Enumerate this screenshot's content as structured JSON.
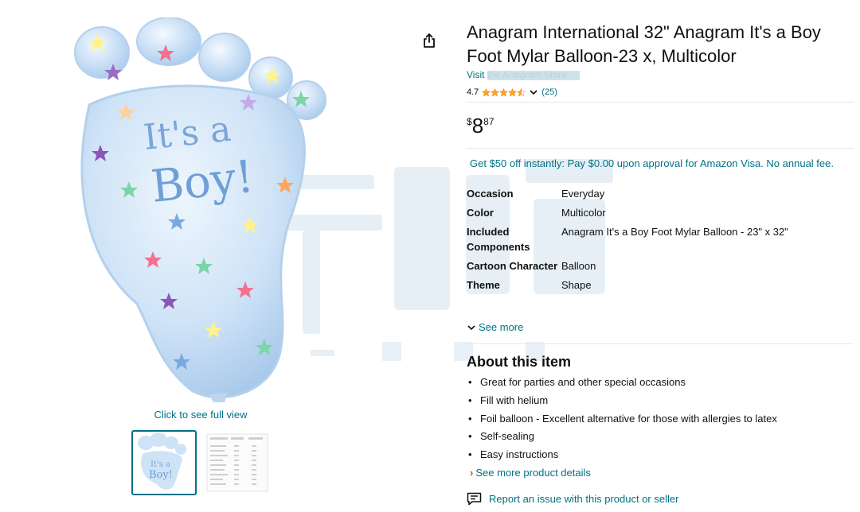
{
  "product": {
    "title": "Anagram International 32\" Anagram It's a Boy Foot Mylar Balloon-23 x, Multicolor",
    "store_link": "Visit the Anagram Store",
    "rating_value": "4.7",
    "rating_stars": 4.5,
    "rating_count": "(25)",
    "price_symbol": "$",
    "price_whole": "8",
    "price_fraction": "87"
  },
  "offer": {
    "visa_text": "Get $50 off instantly: Pay $0.00 upon approval for Amazon Visa. No annual fee."
  },
  "specs": [
    {
      "key": "Occasion",
      "value": "Everyday"
    },
    {
      "key": "Color",
      "value": "Multicolor"
    },
    {
      "key": "Included Components",
      "value": "Anagram It's a Boy Foot Mylar Balloon - 23\" x 32\""
    },
    {
      "key": "Cartoon Character",
      "value": "Balloon"
    },
    {
      "key": "Theme",
      "value": "Shape"
    }
  ],
  "see_more_label": "See more",
  "about": {
    "title": "About this item",
    "bullets": [
      "Great for parties and other special occasions",
      "Fill with helium",
      "Foil balloon - Excellent alternative for those with allergies to latex",
      "Self-sealing",
      "Easy instructions"
    ],
    "details_link": "See more product details"
  },
  "report_link": "Report an issue with this product or seller",
  "gallery": {
    "full_view_label": "Click to see full view",
    "balloon_text_line1": "It's a",
    "balloon_text_line2": "Boy!"
  },
  "icons": {
    "share": "share-icon",
    "star": "star-icon",
    "chevron": "chevron-down-icon",
    "report": "report-icon"
  },
  "colors": {
    "link": "#007185",
    "star": "#ffa41c",
    "detail_arrow": "#c45500",
    "balloon": "#cfe3f7"
  }
}
